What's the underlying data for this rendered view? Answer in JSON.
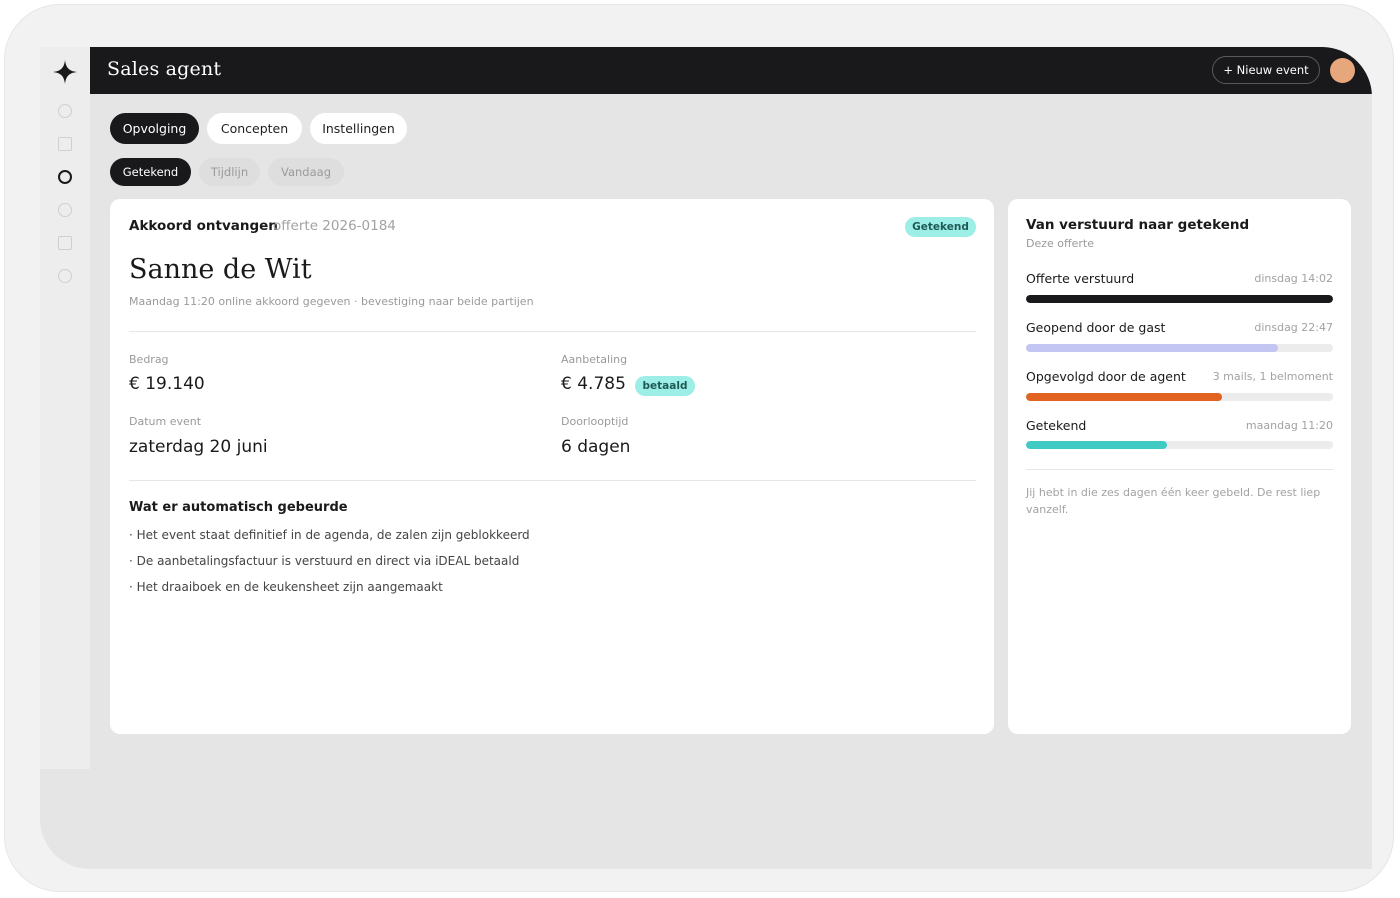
{
  "app": {
    "title": "Sales agent"
  },
  "header": {
    "new_event_label": "+ Nieuw event"
  },
  "tabs": [
    {
      "label": "Opvolging",
      "active": true
    },
    {
      "label": "Concepten",
      "active": false
    },
    {
      "label": "Instellingen",
      "active": false
    }
  ],
  "subtabs": [
    {
      "label": "Getekend",
      "active": true
    },
    {
      "label": "Tijdlijn",
      "active": false
    },
    {
      "label": "Vandaag",
      "active": false
    }
  ],
  "deal": {
    "title": "Akkoord ontvangen",
    "reference": "offerte 2026-0184",
    "status_badge": "Getekend",
    "client_name": "Sanne de Wit",
    "subtitle": "Maandag 11:20 online akkoord gegeven · bevestiging naar beide partijen",
    "fields": {
      "amount_label": "Bedrag",
      "amount_value": "€ 19.140",
      "deposit_label": "Aanbetaling",
      "deposit_value": "€ 4.785",
      "deposit_badge": "betaald",
      "event_date_label": "Datum event",
      "event_date_value": "zaterdag 20 juni",
      "lead_time_label": "Doorlooptijd",
      "lead_time_value": "6 dagen"
    },
    "automation": {
      "title": "Wat er automatisch gebeurde",
      "items": [
        "· Het event staat definitief in de agenda, de zalen zijn geblokkeerd",
        "· De aanbetalingsfactuur is verstuurd en direct via iDEAL betaald",
        "· Het draaiboek en de keukensheet zijn aangemaakt"
      ]
    }
  },
  "progress": {
    "title": "Van verstuurd naar getekend",
    "subtitle": "Deze offerte",
    "steps": [
      {
        "label": "Offerte verstuurd",
        "meta": "dinsdag 14:02",
        "level": 1.0,
        "color": "#19191c"
      },
      {
        "label": "Geopend door de gast",
        "meta": "dinsdag 22:47",
        "level": 0.82,
        "color": "#c3c6f3"
      },
      {
        "label": "Opgevolgd door de agent",
        "meta": "3 mails, 1 belmoment",
        "level": 0.64,
        "color": "#e2621f"
      },
      {
        "label": "Getekend",
        "meta": "maandag 11:20",
        "level": 0.46,
        "color": "#3fcac4"
      }
    ],
    "note": "Jij hebt in die zes dagen één keer gebeld. De rest liep vanzelf."
  },
  "colors": {
    "dark": "#19191c",
    "badge_bg": "#9ceee6",
    "avatar": "#e7a77c"
  }
}
